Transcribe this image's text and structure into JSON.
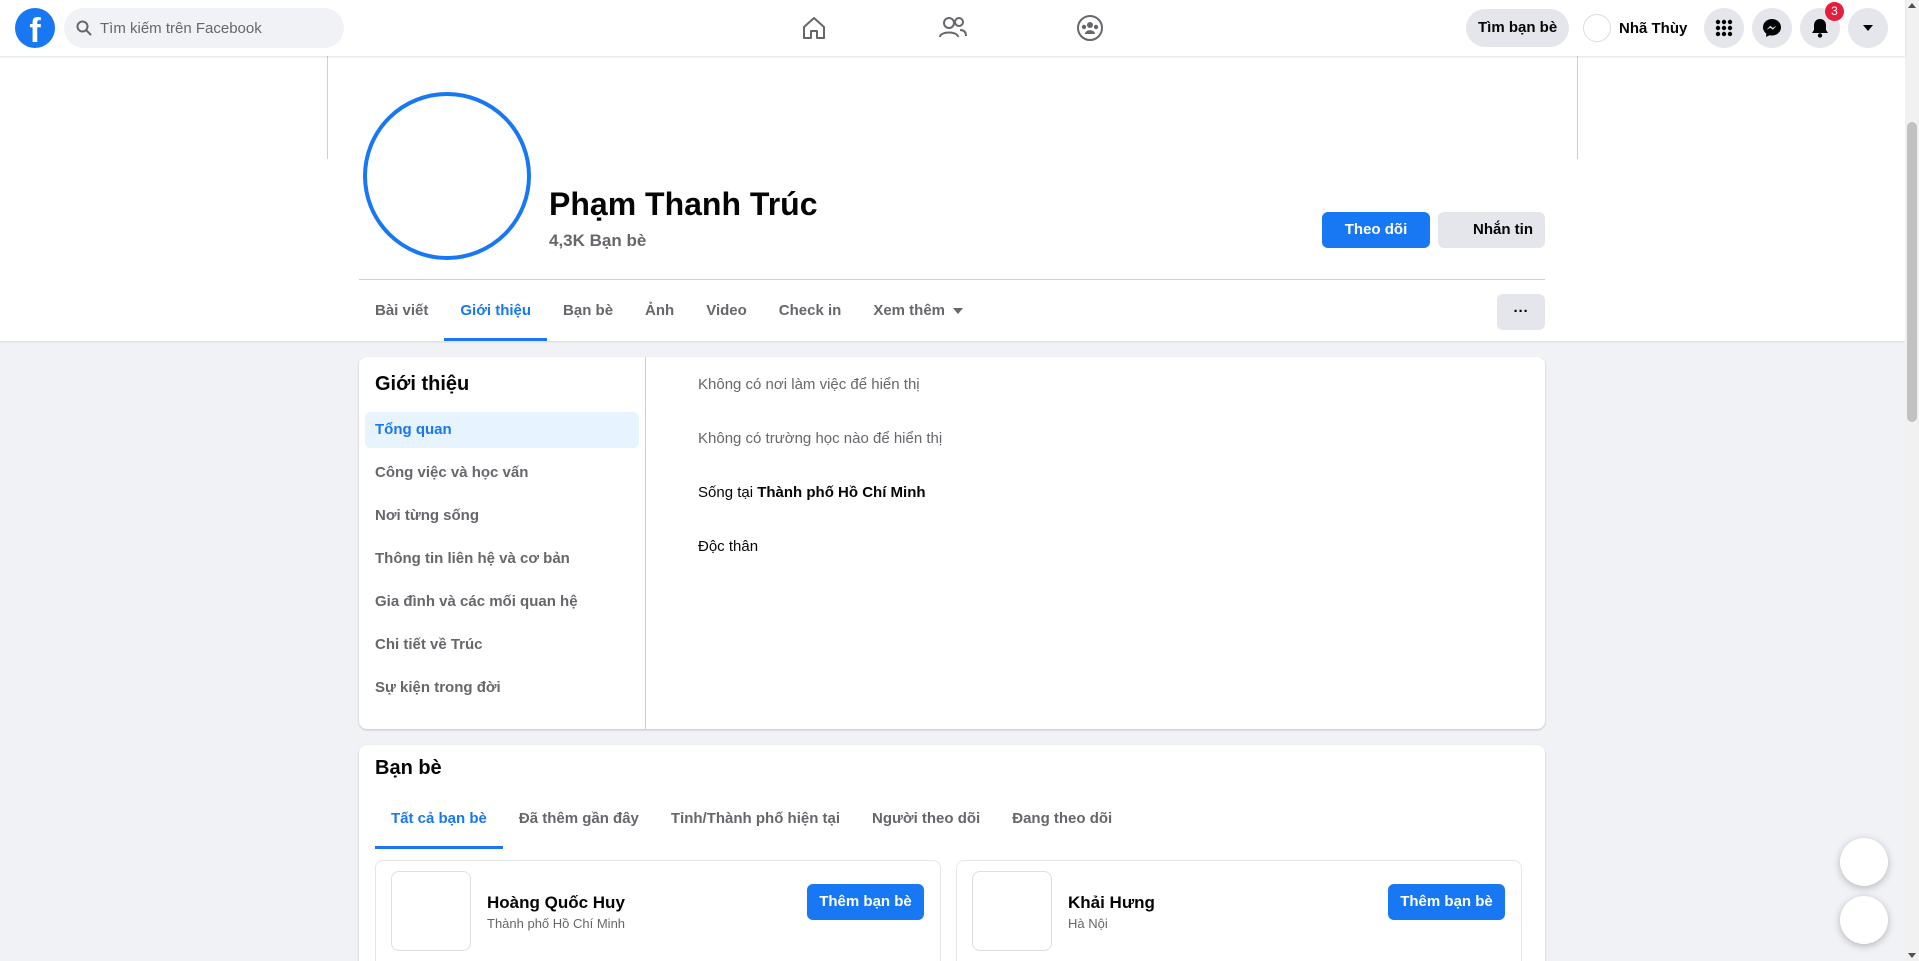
{
  "topbar": {
    "logo_letter": "f",
    "search_placeholder": "Tìm kiếm trên Facebook",
    "find_friends_label": "Tìm bạn bè",
    "user_name": "Nhã Thùy",
    "notification_count": "3"
  },
  "profile": {
    "name": "Phạm Thanh Trúc",
    "friends_count": "4,3K Bạn bè",
    "follow_label": "Theo dõi",
    "message_label": "Nhắn tin",
    "tabs": [
      "Bài viết",
      "Giới thiệu",
      "Bạn bè",
      "Ảnh",
      "Video",
      "Check in",
      "Xem thêm"
    ],
    "active_tab": "Giới thiệu",
    "more_label": "···"
  },
  "intro": {
    "title": "Giới thiệu",
    "menu": [
      "Tổng quan",
      "Công việc và học vấn",
      "Nơi từng sống",
      "Thông tin liên hệ và cơ bản",
      "Gia đình và các mối quan hệ",
      "Chi tiết về Trúc",
      "Sự kiện trong đời"
    ],
    "no_work": "Không có nơi làm việc để hiển thị",
    "no_school": "Không có trường học nào để hiển thị",
    "lives_in_prefix": "Sống tại ",
    "lives_in_city": "Thành phố Hồ Chí Minh",
    "relationship": "Độc thân"
  },
  "friends": {
    "title": "Bạn bè",
    "tabs": [
      "Tất cả bạn bè",
      "Đã thêm gần đây",
      "Tỉnh/Thành phố hiện tại",
      "Người theo dõi",
      "Đang theo dõi"
    ],
    "list": [
      {
        "name": "Hoàng Quốc Huy",
        "location": "Thành phố Hồ Chí Minh",
        "add_label": "Thêm bạn bè"
      },
      {
        "name": "Khải Hưng",
        "location": "Hà Nội",
        "add_label": "Thêm bạn bè"
      }
    ]
  },
  "colors": {
    "brand": "#1877f2",
    "badge": "#e41e3f",
    "background": "#f0f2f5"
  }
}
